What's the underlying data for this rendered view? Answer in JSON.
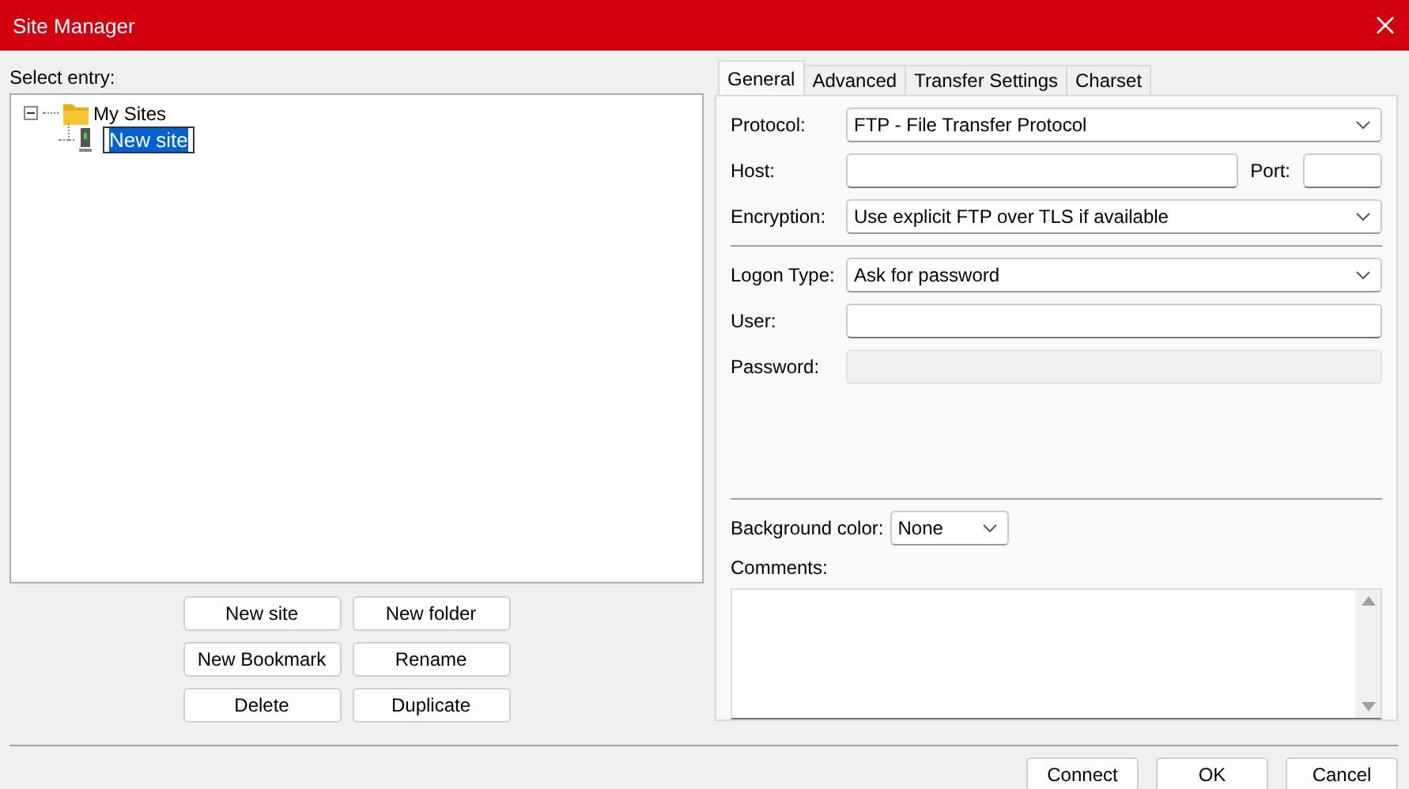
{
  "window": {
    "title": "Site Manager"
  },
  "select_entry_label": "Select entry:",
  "tree": [
    {
      "label": "My Sites",
      "kind": "folder",
      "expanded": true,
      "children": [
        {
          "label": "New site",
          "kind": "site",
          "editing": true
        }
      ]
    }
  ],
  "tree_buttons": [
    "New site",
    "New folder",
    "New Bookmark",
    "Rename",
    "Delete",
    "Duplicate"
  ],
  "tabs": [
    {
      "label": "General",
      "selected": true
    },
    {
      "label": "Advanced",
      "selected": false
    },
    {
      "label": "Transfer Settings",
      "selected": false
    },
    {
      "label": "Charset",
      "selected": false
    }
  ],
  "connection_fields": [
    {
      "kind": "select",
      "label": "Protocol:",
      "value": "FTP - File Transfer Protocol"
    },
    {
      "kind": "host_port",
      "label": "Host:",
      "port_label": "Port:"
    },
    {
      "kind": "select",
      "label": "Encryption:",
      "value": "Use explicit FTP over TLS if available"
    }
  ],
  "logon_fields": [
    {
      "kind": "select",
      "label": "Logon Type:",
      "value": "Ask for password"
    },
    {
      "kind": "input",
      "label": "User:"
    },
    {
      "kind": "input",
      "label": "Password:",
      "disabled": true
    }
  ],
  "background_color": {
    "label": "Background color:",
    "value": "None"
  },
  "comments": {
    "label": "Comments:"
  },
  "buttons": [
    "Connect",
    "OK",
    "Cancel"
  ]
}
